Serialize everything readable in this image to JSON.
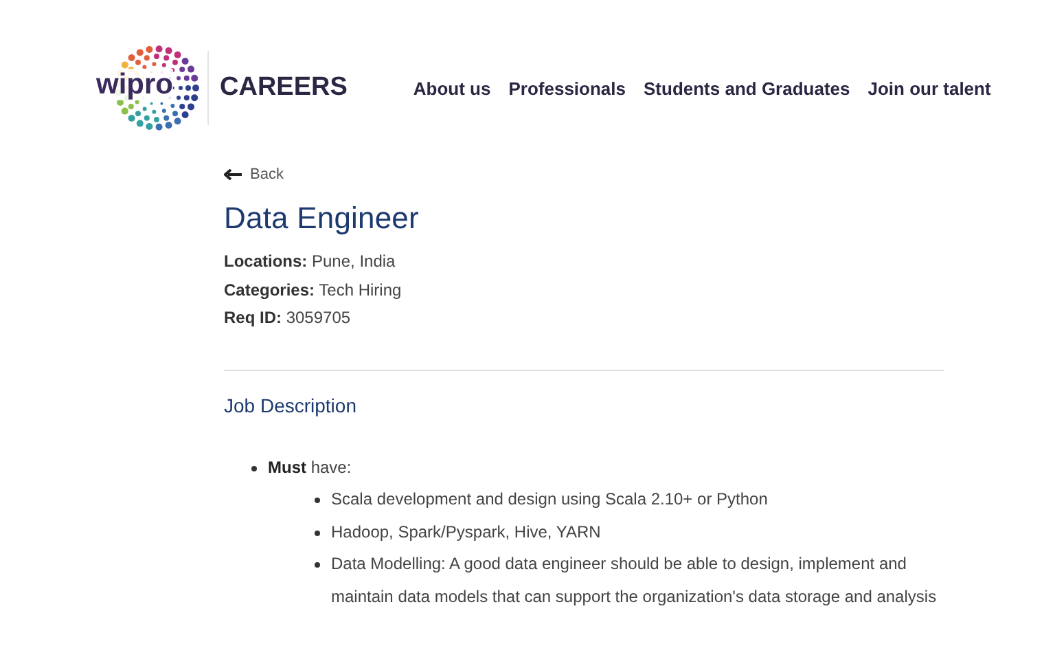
{
  "header": {
    "logo_text": "wipro",
    "site_title": "CAREERS",
    "nav": [
      "About us",
      "Professionals",
      "Students and Graduates",
      "Join our talent"
    ]
  },
  "back_link": "Back",
  "job": {
    "title": "Data Engineer",
    "meta": [
      {
        "label": "Locations:",
        "value": "Pune, India"
      },
      {
        "label": "Categories:",
        "value": "Tech Hiring"
      },
      {
        "label": "Req ID:",
        "value": "3059705"
      }
    ]
  },
  "section": {
    "heading": "Job Description",
    "items": [
      {
        "text": "**Must** have:",
        "children": [
          {
            "text": "Scala development and design using Scala 2.10+ or Python"
          },
          {
            "text": "Hadoop, Spark/Pyspark, Hive, YARN"
          },
          {
            "text": "Data Modelling: A good data engineer should be able to design, implement and maintain data models that can support the organization's data storage and analysis"
          }
        ]
      }
    ]
  }
}
